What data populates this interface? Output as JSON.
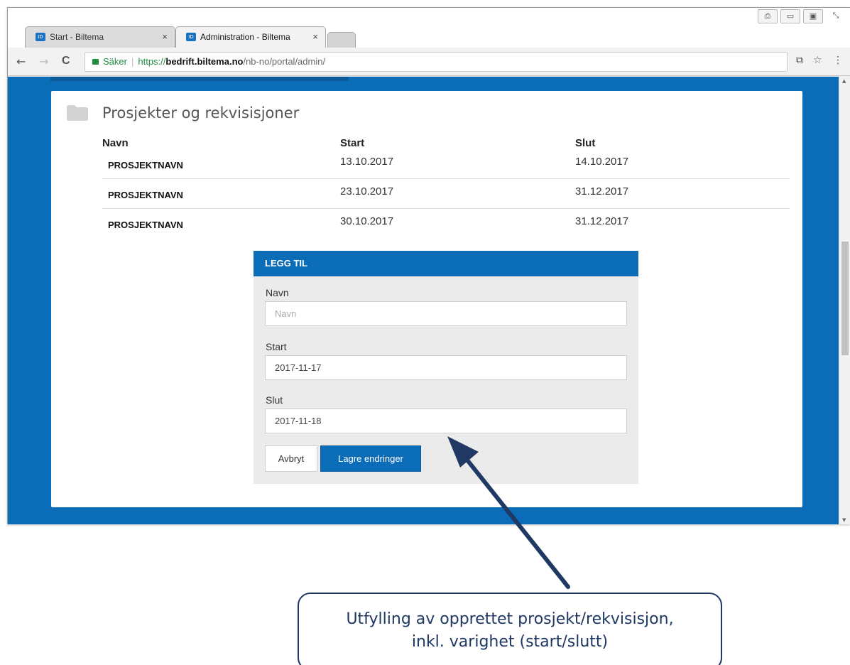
{
  "browser": {
    "tabs": [
      {
        "title": "Start - Biltema",
        "close": "×",
        "favicon": "ID"
      },
      {
        "title": "Administration - Biltema",
        "close": "×",
        "favicon": "ID"
      }
    ],
    "window_controls": [
      "⎙",
      "▭",
      "▣",
      "⤡"
    ],
    "nav": {
      "back": "←",
      "forward": "→",
      "reload": "C"
    },
    "address": {
      "secure_label": "Säker",
      "separator": "|",
      "scheme": "https://",
      "host": "bedrift.biltema.no",
      "path": "/nb-no/portal/admin/"
    },
    "toolbar_right": {
      "translate": "⧉",
      "star": "☆",
      "menu": "⋮"
    }
  },
  "card": {
    "title": "Prosjekter og rekvisisjoner",
    "columns": {
      "name": "Navn",
      "start": "Start",
      "end": "Slut"
    },
    "rows": [
      {
        "name": "PROSJEKTNAVN",
        "start": "13.10.2017",
        "end": "14.10.2017"
      },
      {
        "name": "PROSJEKTNAVN",
        "start": "23.10.2017",
        "end": "31.12.2017"
      },
      {
        "name": "PROSJEKTNAVN",
        "start": "30.10.2017",
        "end": "31.12.2017"
      }
    ]
  },
  "form": {
    "header": "LEGG TIL",
    "name_label": "Navn",
    "name_placeholder": "Navn",
    "name_value": "",
    "start_label": "Start",
    "start_value": "2017-11-17",
    "end_label": "Slut",
    "end_value": "2017-11-18",
    "cancel_label": "Avbryt",
    "save_label": "Lagre endringer"
  },
  "callout": {
    "line1": "Utfylling av opprettet prosjekt/rekvisisjon,",
    "line2": "inkl. varighet (start/slutt)"
  },
  "colors": {
    "brand_blue": "#0b6cb8",
    "callout_navy": "#1f3864",
    "secure_green": "#1e8e3e"
  }
}
